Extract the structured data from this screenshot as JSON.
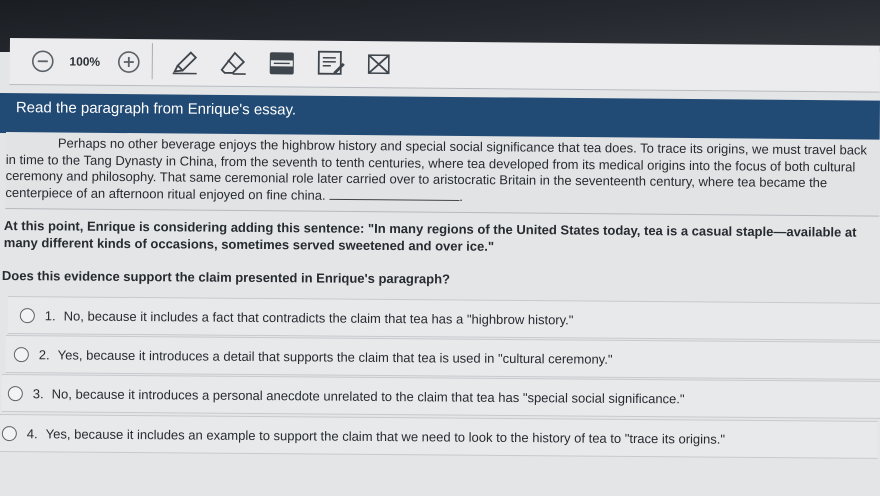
{
  "toolbar": {
    "zoom_out_icon": "minus-circle-icon",
    "zoom_level": "100%",
    "zoom_in_icon": "plus-circle-icon",
    "zoom_in_symbol": "+",
    "tools": [
      "highlighter-icon",
      "eraser-icon",
      "line-reader-icon",
      "notepad-icon",
      "answer-eliminator-icon"
    ]
  },
  "header": {
    "title": "Read the paragraph from Enrique's essay."
  },
  "passage": {
    "text": "Perhaps no other beverage enjoys the highbrow history and special social significance that tea does. To trace its origins, we must travel back in time to the Tang Dynasty in China, from the seventh to tenth centuries, where tea developed from its medical origins into the focus of both cultural ceremony and philosophy. That same ceremonial role later carried over to aristocratic Britain in the seventeenth century, where tea became the centerpiece of an afternoon ritual enjoyed on fine china.",
    "end_punct": "."
  },
  "context": "At this point, Enrique is considering adding this sentence: \"In many regions of the United States today, tea is a casual staple—available at many different kinds of occasions, sometimes served sweetened and over ice.\"",
  "question": "Does this evidence support the claim presented in Enrique's paragraph?",
  "answers": [
    {
      "num": "1.",
      "text": "No, because it includes a fact that contradicts the claim that tea has a \"highbrow history.\""
    },
    {
      "num": "2.",
      "text": "Yes, because it introduces a detail that supports the claim that tea is used in \"cultural ceremony.\""
    },
    {
      "num": "3.",
      "text": "No, because it introduces a personal anecdote unrelated to the claim that tea has \"special social significance.\""
    },
    {
      "num": "4.",
      "text": "Yes, because it includes an example to support the claim that we need to look to the history of tea to \"trace its origins.\""
    }
  ]
}
